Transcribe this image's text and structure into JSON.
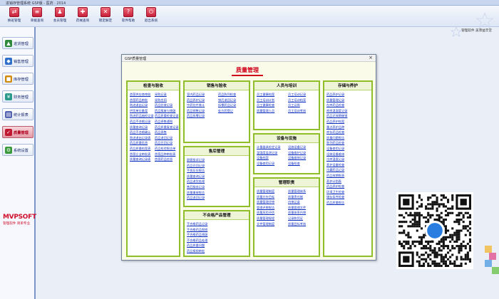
{
  "app_title": "进销存管理系统 GSP版 - 医药 · 2014",
  "toolbar": [
    {
      "label": "换班管理",
      "glyph": "⇄",
      "icon": "shift-icon"
    },
    {
      "label": "单据查询",
      "glyph": "≡",
      "icon": "document-search-icon"
    },
    {
      "label": "会员管理",
      "glyph": "♟",
      "icon": "member-icon"
    },
    {
      "label": "药械查询",
      "glyph": "✚",
      "icon": "drug-search-icon"
    },
    {
      "label": "锁定解定",
      "glyph": "✕",
      "icon": "lock-icon"
    },
    {
      "label": "软件帮助",
      "glyph": "?",
      "icon": "help-icon"
    },
    {
      "label": "退出系统",
      "glyph": "⏻",
      "icon": "exit-icon"
    }
  ],
  "status_text": "管理软件 美萍益丰堂",
  "sidebar": [
    {
      "label": "进货管理",
      "color": "#2e8a3a",
      "glyph": "▲"
    },
    {
      "label": "销售管理",
      "color": "#2f6fc9",
      "glyph": "◆"
    },
    {
      "label": "库存管理",
      "color": "#d08a10",
      "glyph": "■"
    },
    {
      "label": "财务管理",
      "color": "#2a9a8c",
      "glyph": "¥"
    },
    {
      "label": "统计报表",
      "color": "#5564b0",
      "glyph": "▤"
    },
    {
      "label": "质量管理",
      "color": "#c01830",
      "glyph": "✓",
      "active": true
    },
    {
      "label": "系统设置",
      "color": "#3a9a3a",
      "glyph": "⚙"
    }
  ],
  "brand": {
    "logo": "MVPSOFT",
    "tagline": "管理软件 简单专业"
  },
  "dialog": {
    "window_title": "GSP质量管理",
    "close": "×",
    "heading": "质量管理",
    "panels": [
      {
        "id": "purchase-check",
        "title": "检查与验收",
        "items": [
          "首营供应商审批",
          "采购记录",
          "首营药品审批",
          "采购合同",
          "购进退出记录",
          "药品验收记录",
          "供货单位备案",
          "药品报废与销毁",
          "购进药品抽检记录",
          "药品质量检查记录",
          "药品不合格记录",
          "药品停售通知",
          "质量查询记录",
          "药品质量复查记录",
          "药品不合格确认",
          "药品停售",
          "购进退出记录表",
          "药品退回记录",
          "药品质量信息",
          "药品召回记录",
          "药品质量档案表",
          "药品检验报告单",
          "首营企业审批表",
          "首营品种审批表",
          "质量查询记录表",
          "首营药品信息"
        ]
      },
      {
        "id": "sales-check",
        "title": "销售与验收",
        "items": [
          "室内药品记录",
          "药品陈列检查",
          "药品养护记录",
          "销后退回记录",
          "中药饮片装斗",
          "拆零药品记录",
          "药品销售记录",
          "处方药登记",
          "药品拆零记录"
        ]
      },
      {
        "id": "personnel",
        "title": "人员与培训",
        "items": [
          "员工健康档案",
          "员工培训记录",
          "员工培训计划",
          "员工培训档案",
          "员工健康检查",
          "员工证照",
          "质量管理人员",
          "员工培训考核"
        ]
      },
      {
        "id": "storage",
        "title": "存储与养护",
        "items": [
          "药品养护记录",
          "质量管理记录",
          "在库药品检查",
          "库房温湿度记录",
          "药品近效期催销",
          "药品养护档案",
          "重点养护品种",
          "库存药品检查",
          "质量问题报告",
          "陈列药品检查",
          "设备使用记录",
          "设施设备维修",
          "冷库温度记录",
          "养护设备检查",
          "冷藏药品记录",
          "药品效期报表",
          "养护计划表",
          "药品养护检查",
          "环境卫生检查",
          "储存条件检查",
          "药品质量报告"
        ]
      },
      {
        "id": "equipment",
        "title": "设备与设施",
        "items": [
          "计量器具检定记录",
          "设施设备记录",
          "温湿度监测记录",
          "设备维护记录",
          "设备档案",
          "设备维修记录",
          "设备使用记录",
          "设备检查"
        ]
      },
      {
        "id": "after-sales",
        "title": "售后管理",
        "items": [
          "顾客投诉记录",
          "药品召回记录",
          "不良反应报告",
          "质量查询记录",
          "药品退货处理",
          "售后服务记录",
          "质量事故报告",
          "药品追回记录"
        ]
      },
      {
        "id": "management",
        "title": "管理职责",
        "items": [
          "质量管理制度",
          "质量管理体系",
          "质量方针目标",
          "质量责任制",
          "质量管理评审",
          "内审记录",
          "管理评审报告",
          "质量管理文件",
          "质量风险评估",
          "质量体系内审",
          "质量管理规程",
          "记录和凭证",
          "文件管理制度",
          "质量目标考核"
        ]
      },
      {
        "id": "nonconforming",
        "title": "不合格产品管理",
        "items": [
          "不合格药品记录",
          "不合格药品报损",
          "不合格药品销毁",
          "不合格药品处理",
          "药品质量问题",
          "药品报损审批"
        ]
      }
    ]
  }
}
